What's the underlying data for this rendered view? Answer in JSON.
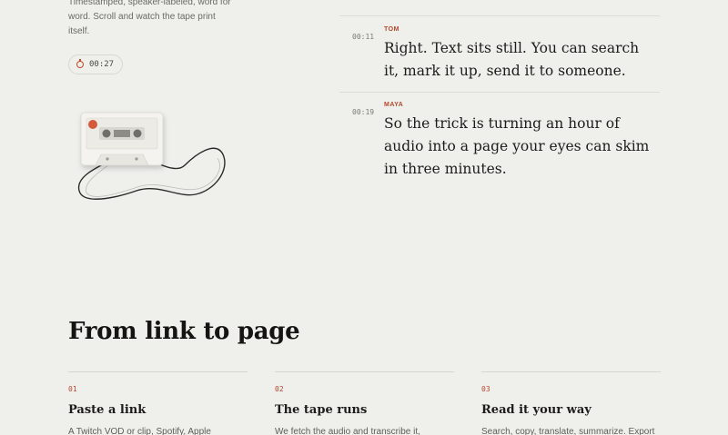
{
  "intro": {
    "text": "Timestamped, speaker-labeled, word for word. Scroll and watch the tape print itself."
  },
  "timer": {
    "time": "00:27",
    "icon": "clock-icon"
  },
  "illustration": {
    "name": "cassette-tape",
    "accent": "#d35a3a"
  },
  "transcript": [
    {
      "time": "00:11",
      "speaker": "TOM",
      "text": "Right. Text sits still. You can search it, mark it up, send it to someone."
    },
    {
      "time": "00:19",
      "speaker": "MAYA",
      "text": "So the trick is turning an hour of audio into a page your eyes can skim in three minutes."
    }
  ],
  "section": {
    "title": "From link to page",
    "steps": [
      {
        "num": "01",
        "title": "Paste a link",
        "desc": "A Twitch VOD or clip, Spotify, Apple"
      },
      {
        "num": "02",
        "title": "The tape runs",
        "desc": "We fetch the audio and transcribe it,"
      },
      {
        "num": "03",
        "title": "Read it your way",
        "desc": "Search, copy, translate, summarize. Export"
      }
    ]
  },
  "colors": {
    "background": "#efefec",
    "accent": "#b5472a",
    "text": "#1d1c1a"
  }
}
